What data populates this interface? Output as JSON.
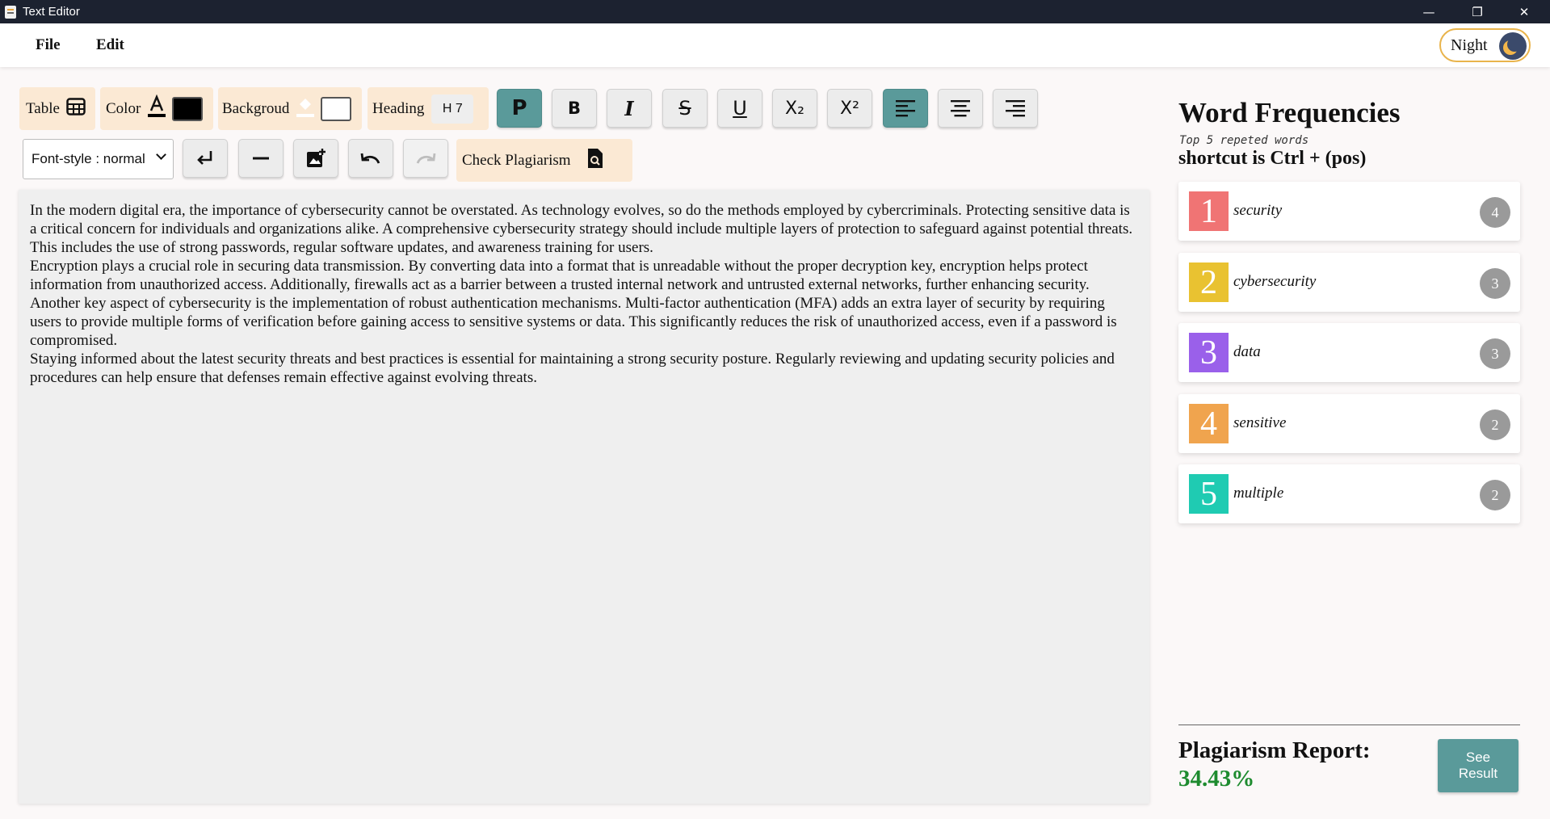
{
  "window": {
    "title": "Text Editor",
    "minimize": "—",
    "restore": "❐",
    "close": "✕"
  },
  "menu": {
    "file": "File",
    "edit": "Edit",
    "night_label": "Night"
  },
  "toolbar": {
    "table_label": "Table",
    "color_label": "Color",
    "color_value": "#000000",
    "background_label": "Backgroud",
    "background_value": "#ffffff",
    "heading_label": "Heading",
    "heading_value": "H 7",
    "paragraph_label": "P",
    "bold_label": "B",
    "italic_label": "I",
    "strike_label": "S",
    "underline_label": "U",
    "subscript_label": "X₂",
    "superscript_label": "X²",
    "font_style_value": "Font-style : normal",
    "check_plagiarism_label": "Check Plagiarism",
    "active_color": "#5a9a9a"
  },
  "editor": {
    "paragraphs": [
      "In the modern digital era, the importance of cybersecurity cannot be overstated. As technology evolves, so do the methods employed by cybercriminals. Protecting sensitive data is a critical concern for individuals and organizations alike. A comprehensive cybersecurity strategy should include multiple layers of protection to safeguard against potential threats. This includes the use of strong passwords, regular software updates, and awareness training for users.",
      "Encryption plays a crucial role in securing data transmission. By converting data into a format that is unreadable without the proper decryption key, encryption helps protect information from unauthorized access. Additionally, firewalls act as a barrier between a trusted internal network and untrusted external networks, further enhancing security.",
      "Another key aspect of cybersecurity is the implementation of robust authentication mechanisms. Multi-factor authentication (MFA) adds an extra layer of security by requiring users to provide multiple forms of verification before gaining access to sensitive systems or data. This significantly reduces the risk of unauthorized access, even if a password is compromised.",
      "Staying informed about the latest security threats and best practices is essential for maintaining a strong security posture. Regularly reviewing and updating security policies and procedures can help ensure that defenses remain effective against evolving threats."
    ]
  },
  "frequencies": {
    "title": "Word Frequencies",
    "subtitle": "Top 5 repeted words",
    "shortcut": "shortcut is Ctrl + (pos)",
    "items": [
      {
        "rank": "1",
        "word": "security",
        "count": "4",
        "color": "#f07474"
      },
      {
        "rank": "2",
        "word": "cybersecurity",
        "count": "3",
        "color": "#e9c231"
      },
      {
        "rank": "3",
        "word": "data",
        "count": "3",
        "color": "#9a60ea"
      },
      {
        "rank": "4",
        "word": "sensitive",
        "count": "2",
        "color": "#f0a44e"
      },
      {
        "rank": "5",
        "word": "multiple",
        "count": "2",
        "color": "#1fcbb2"
      }
    ]
  },
  "report": {
    "label": "Plagiarism Report:",
    "value": "34.43%",
    "see_result_label": "See Result"
  }
}
